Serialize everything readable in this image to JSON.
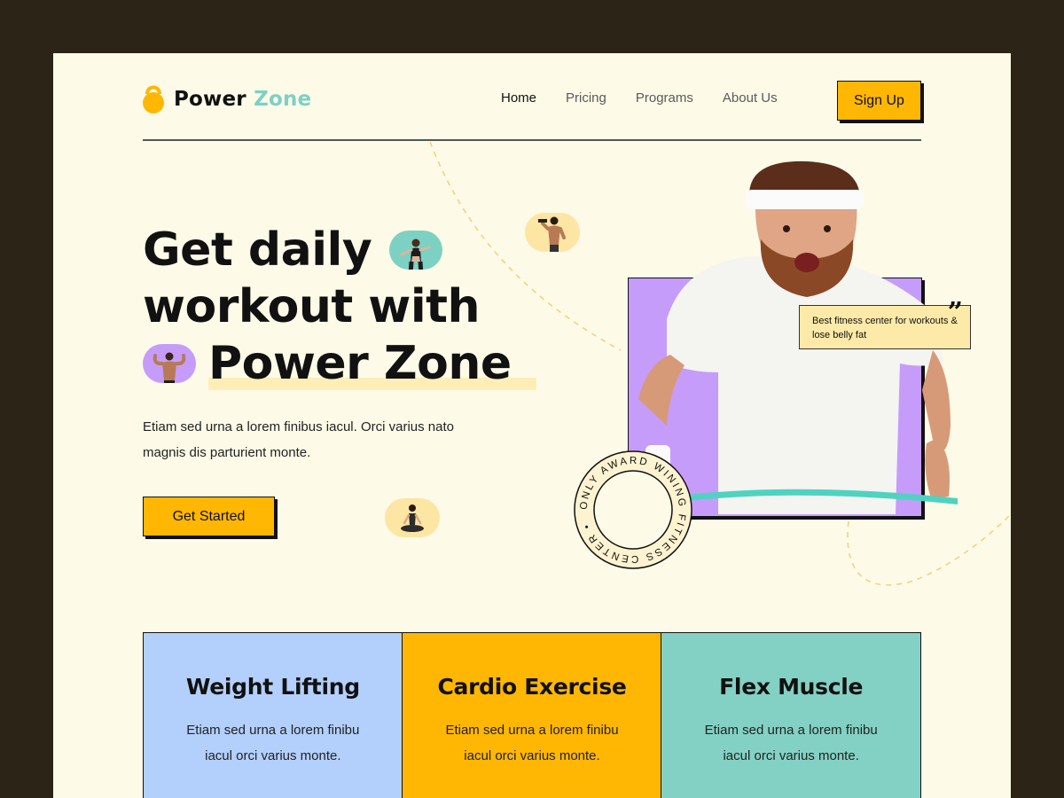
{
  "brand": {
    "name_part1": "Power",
    "name_part2": "Zone"
  },
  "nav": {
    "items": [
      {
        "label": "Home",
        "active": true
      },
      {
        "label": "Pricing",
        "active": false
      },
      {
        "label": "Programs",
        "active": false
      },
      {
        "label": "About Us",
        "active": false
      }
    ],
    "signup_label": "Sign Up"
  },
  "hero": {
    "title_line1": "Get daily",
    "title_line2": "workout with",
    "title_line3": "Power Zone",
    "description": "Etiam sed urna a lorem finibus iacul. Orci varius nato magnis dis parturient monte.",
    "cta_label": "Get Started",
    "quote": "Best fitness center for workouts & lose belly fat",
    "badge_text": "ONLY AWARD WINING FITNESS CENTER •"
  },
  "cards": [
    {
      "title": "Weight Lifting",
      "text": "Etiam sed urna a lorem finibu iacul orci varius monte.",
      "color": "#b3d0fc"
    },
    {
      "title": "Cardio Exercise",
      "text": "Etiam sed urna a lorem finibu iacul orci varius monte.",
      "color": "#ffb703"
    },
    {
      "title": "Flex Muscle",
      "text": "Etiam sed urna a lorem finibu iacul orci varius monte.",
      "color": "#83d1c4"
    }
  ],
  "colors": {
    "accent": "#ffb703",
    "teal": "#7dd1c3",
    "purple": "#c69cfa",
    "background": "#fefae8",
    "frame": "#2c2416"
  },
  "icons": [
    "kettlebell-icon",
    "quote-icon"
  ]
}
